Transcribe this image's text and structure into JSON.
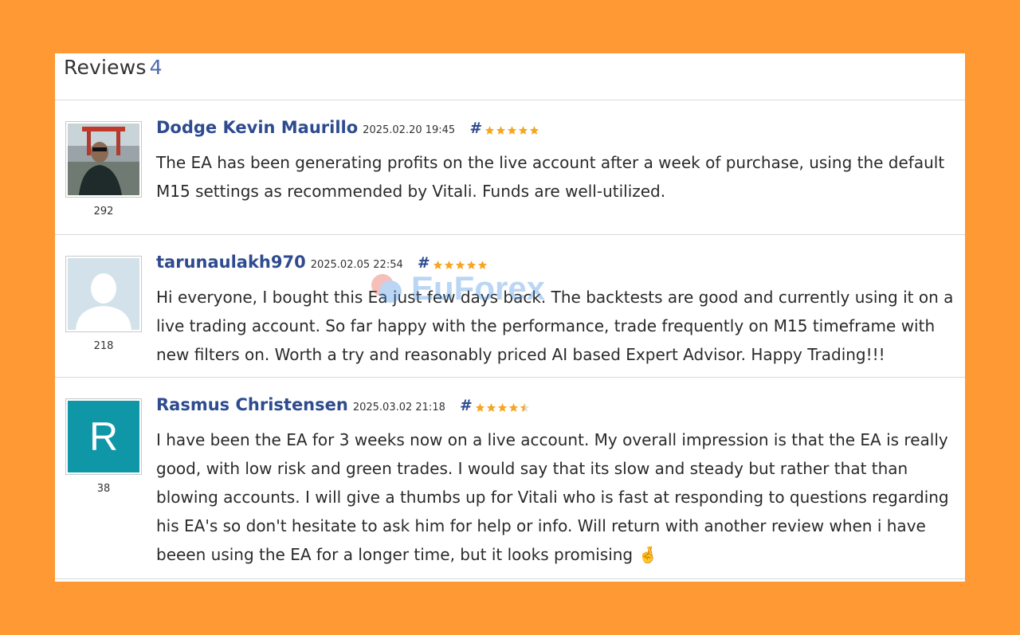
{
  "header": {
    "title": "Reviews",
    "count": "4"
  },
  "watermark": {
    "text": "EuForex"
  },
  "colors": {
    "background": "#FF9933",
    "author": "#2e4b8f",
    "star": "#f5a623",
    "letter_avatar": "#0f97a8"
  },
  "reviews": [
    {
      "author": "Dodge Kevin Maurillo",
      "date": "2025.02.20 19:45",
      "hash": "#",
      "rating": 5,
      "rating_count": "292",
      "avatar": "photo",
      "text": "The EA has been generating profits on the live account after a week of purchase, using the default M15 settings as recommended by Vitali. Funds are well-utilized."
    },
    {
      "author": "tarunaulakh970",
      "date": "2025.02.05 22:54",
      "hash": "#",
      "rating": 5,
      "rating_count": "218",
      "avatar": "default-user-icon",
      "text": "Hi everyone, I bought this Ea just few days back. The backtests are good and currently using it on a live trading account. So far happy with the performance, trade frequently on M15 timeframe with new filters on. Worth a try and reasonably priced AI based Expert Advisor. Happy Trading!!!"
    },
    {
      "author": "Rasmus Christensen",
      "date": "2025.03.02 21:18",
      "hash": "#",
      "rating": 4.5,
      "rating_count": "38",
      "avatar_letter": "R",
      "text": "I have been the EA for 3 weeks now on a live account. My overall impression is that the EA is really good, with low risk and green trades. I would say that its slow and steady but rather that than blowing accounts. I will give a thumbs up for Vitali who is fast at responding to questions regarding his EA's so don't hesitate to ask him for help or info. Will return with another review when i have beeen using the EA for a longer time, but it looks promising 🤞"
    }
  ]
}
